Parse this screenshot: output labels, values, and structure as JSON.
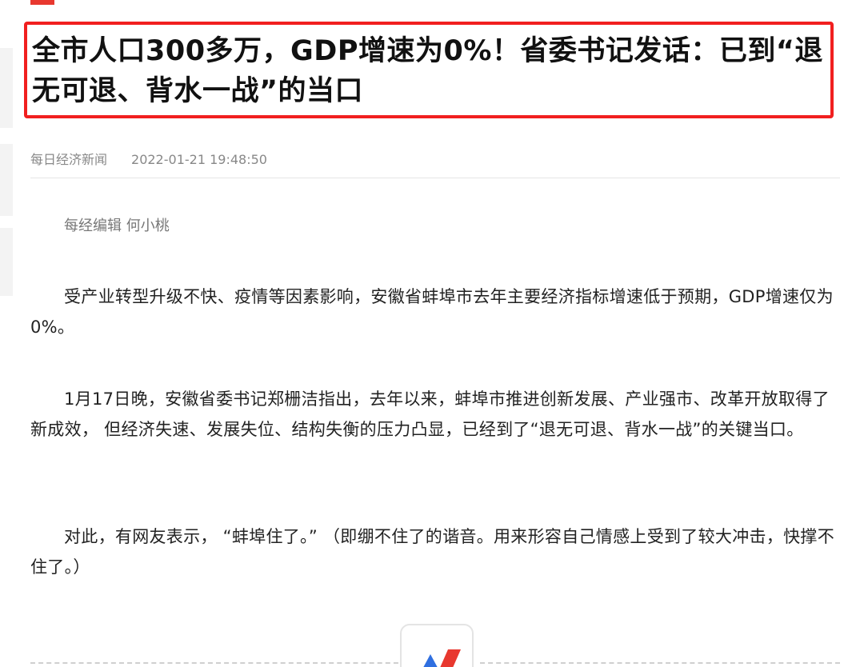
{
  "article": {
    "title": "全市人口300多万，GDP增速为0%！省委书记发话：已到“退无可退、背水一战”的当口",
    "source": "每日经济新闻",
    "datetime": "2022-01-21 19:48:50",
    "editor": "每经编辑 何小桃",
    "paragraphs": [
      "受产业转型升级不快、疫情等因素影响，安徽省蚌埠市去年主要经济指标增速低于预期，GDP增速仅为0%。",
      "1月17日晚，安徽省委书记郑栅洁指出，去年以来，蚌埠市推进创新发展、产业强市、改革开放取得了新成效， 但经济失速、发展失位、结构失衡的压力凸显，已经到了“退无可退、背水一战”的关键当口。",
      "对此，有网友表示， “蚌埠住了。” （即绷不住了的谐音。用来形容自己情感上受到了较大冲击，快撑不住了。）"
    ]
  },
  "colors": {
    "highlight_border": "#f11f1f",
    "accent": "#e8382f",
    "logo_blue": "#2f6fe0",
    "logo_red": "#e8382f"
  },
  "icons": {
    "logo": "publisher-logo-icon"
  }
}
